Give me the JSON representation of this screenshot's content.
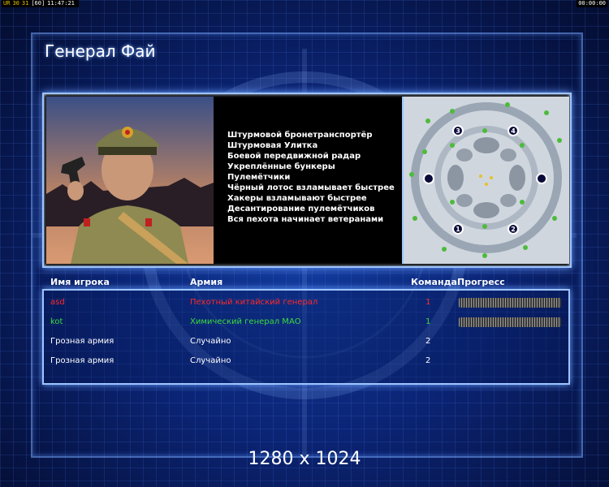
{
  "hud": {
    "left_items": [
      "UR",
      "30",
      "31",
      "[60]",
      "11:47:21"
    ],
    "right_time": "00:00:00"
  },
  "general_name": "Генерал Фай",
  "features": [
    "Штурмовой бронетранспортёр",
    "Штурмовая Улитка",
    "Боевой передвижной радар",
    "Укреплённые бункеры",
    "Пулемётчики",
    "Чёрный лотос взламывает быстрее",
    "Хакеры взламывают быстрее",
    "Десантирование пулемётчиков",
    "Вся пехота начинает ветеранами"
  ],
  "minimap": {
    "start_positions": [
      "1",
      "2",
      "3",
      "4"
    ]
  },
  "table": {
    "headers": {
      "player": "Имя игрока",
      "army": "Армия",
      "team": "Команда",
      "progress": "Прогресс"
    },
    "rows": [
      {
        "player": "asd",
        "army": "Пехотный китайский генерал",
        "team": "1",
        "color": "#ff2a2a",
        "has_progress": true
      },
      {
        "player": "kot",
        "army": "Химический генерал МАО",
        "team": "1",
        "color": "#3cdc3c",
        "has_progress": true
      },
      {
        "player": "Грозная армия",
        "army": "Случайно",
        "team": "2",
        "color": "#ffffff",
        "has_progress": false
      },
      {
        "player": "Грозная армия",
        "army": "Случайно",
        "team": "2",
        "color": "#ffffff",
        "has_progress": false
      }
    ]
  },
  "resolution": "1280 x 1024",
  "colors": {
    "panel_border": "#9ec4ff",
    "background": "#0b2474",
    "player1": "#ff2a2a",
    "player2": "#3cdc3c"
  }
}
